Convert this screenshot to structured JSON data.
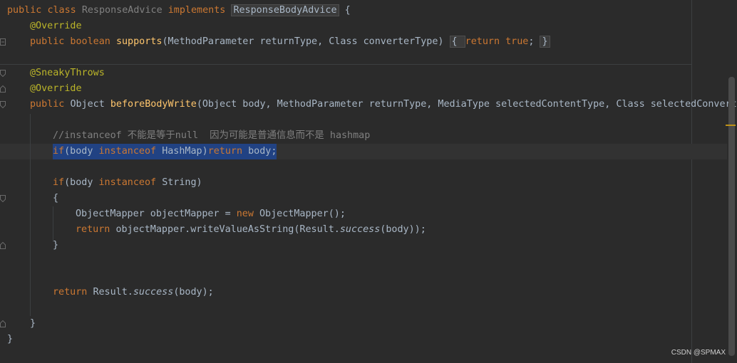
{
  "editor": {
    "lines": [
      {
        "id": "l1",
        "tokens": [
          [
            "kw",
            "public "
          ],
          [
            "kw",
            "class "
          ],
          [
            "dim",
            "ResponseAdvice "
          ],
          [
            "kw",
            "implements "
          ],
          [
            "hlbox",
            "ResponseBodyAdvice"
          ],
          [
            "",
            "&nbsp;{"
          ]
        ]
      },
      {
        "id": "l2",
        "tokens": [
          [
            "ann",
            "@Override"
          ]
        ]
      },
      {
        "id": "l3",
        "tokens": [
          [
            "kw",
            "public boolean "
          ],
          [
            "fn",
            "supports"
          ],
          [
            "",
            "(MethodParameter returnType, Class converterType) "
          ],
          [
            "hlbox",
            "{ "
          ],
          [
            "kw",
            "return true"
          ],
          [
            "",
            "; "
          ],
          [
            "hlbox2",
            "}"
          ]
        ]
      },
      {
        "id": "l4",
        "tokens": [
          [
            "ann",
            "@SneakyThrows"
          ]
        ]
      },
      {
        "id": "l5",
        "tokens": [
          [
            "ann",
            "@Override"
          ]
        ]
      },
      {
        "id": "l6",
        "tokens": [
          [
            "kw",
            "public "
          ],
          [
            "",
            "Object "
          ],
          [
            "fn",
            "beforeBodyWrite"
          ],
          [
            "",
            "(Object body, MethodParameter returnType, MediaType selectedContentType, Class selectedConverte"
          ]
        ]
      },
      {
        "id": "l7",
        "tokens": [
          [
            "cmt",
            "//instanceof 不能是等于null  因为可能是普通信息而不是 hashmap"
          ]
        ]
      },
      {
        "id": "l8",
        "tokens": [
          [
            "kw",
            "if"
          ],
          [
            "",
            "(body "
          ],
          [
            "kw",
            "instanceof "
          ],
          [
            "",
            "HashMap)"
          ],
          [
            "kw",
            "return "
          ],
          [
            "",
            "body;"
          ]
        ]
      },
      {
        "id": "l9",
        "tokens": [
          [
            "kw",
            "if"
          ],
          [
            "",
            "(body "
          ],
          [
            "kw",
            "instanceof "
          ],
          [
            "",
            "String)"
          ]
        ]
      },
      {
        "id": "l10",
        "tokens": [
          [
            "",
            "{"
          ]
        ]
      },
      {
        "id": "l11",
        "tokens": [
          [
            "",
            "ObjectMapper objectMapper = "
          ],
          [
            "kw",
            "new "
          ],
          [
            "",
            "ObjectMapper();"
          ]
        ]
      },
      {
        "id": "l12",
        "tokens": [
          [
            "kw",
            "return "
          ],
          [
            "",
            "objectMapper.writeValueAsString(Result."
          ],
          [
            "ital",
            "success"
          ],
          [
            "",
            "(body));"
          ]
        ]
      },
      {
        "id": "l13",
        "tokens": [
          [
            "",
            "}"
          ]
        ]
      },
      {
        "id": "l14",
        "tokens": [
          [
            "kw",
            "return "
          ],
          [
            "",
            "Result."
          ],
          [
            "ital",
            "success"
          ],
          [
            "",
            "(body);"
          ]
        ]
      },
      {
        "id": "l15",
        "tokens": [
          [
            "",
            "}"
          ]
        ]
      },
      {
        "id": "l16",
        "tokens": [
          [
            "",
            "}"
          ]
        ]
      }
    ]
  },
  "watermark": "CSDN @SPMAX"
}
